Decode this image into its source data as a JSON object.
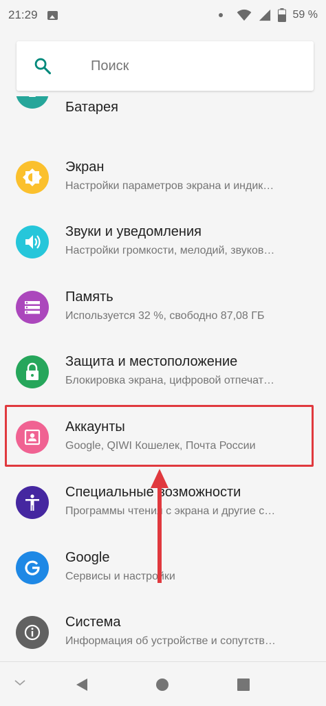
{
  "status_bar": {
    "time": "21:29",
    "battery_percent": "59 %"
  },
  "search": {
    "placeholder": "Поиск"
  },
  "settings_items": [
    {
      "title": "Батарея",
      "subtitle": "",
      "icon": "battery-icon",
      "color": "#26a69a"
    },
    {
      "title": "Экран",
      "subtitle": "Настройки параметров экрана и индик…",
      "icon": "brightness-icon",
      "color": "#fbc02d"
    },
    {
      "title": "Звуки и уведомления",
      "subtitle": "Настройки громкости, мелодий, звуков…",
      "icon": "volume-icon",
      "color": "#26c6da"
    },
    {
      "title": "Память",
      "subtitle": "Используется 32 %, свободно 87,08 ГБ",
      "icon": "storage-icon",
      "color": "#ab47bc"
    },
    {
      "title": "Защита и местоположение",
      "subtitle": "Блокировка экрана, цифровой отпечат…",
      "icon": "lock-icon",
      "color": "#26a65b"
    },
    {
      "title": "Аккаунты",
      "subtitle": "Google, QIWI Кошелек, Почта России",
      "icon": "account-icon",
      "color": "#f06292"
    },
    {
      "title": "Специальные возможности",
      "subtitle": "Программы чтения с экрана и другие с…",
      "icon": "accessibility-icon",
      "color": "#4527a0"
    },
    {
      "title": "Google",
      "subtitle": "Сервисы и настройки",
      "icon": "google-icon",
      "color": "#1e88e5"
    },
    {
      "title": "Система",
      "subtitle": "Информация об устройстве и сопутств…",
      "icon": "info-icon",
      "color": "#616161"
    }
  ],
  "colors": {
    "highlight": "#e0393e",
    "search_icon": "#00897b"
  }
}
